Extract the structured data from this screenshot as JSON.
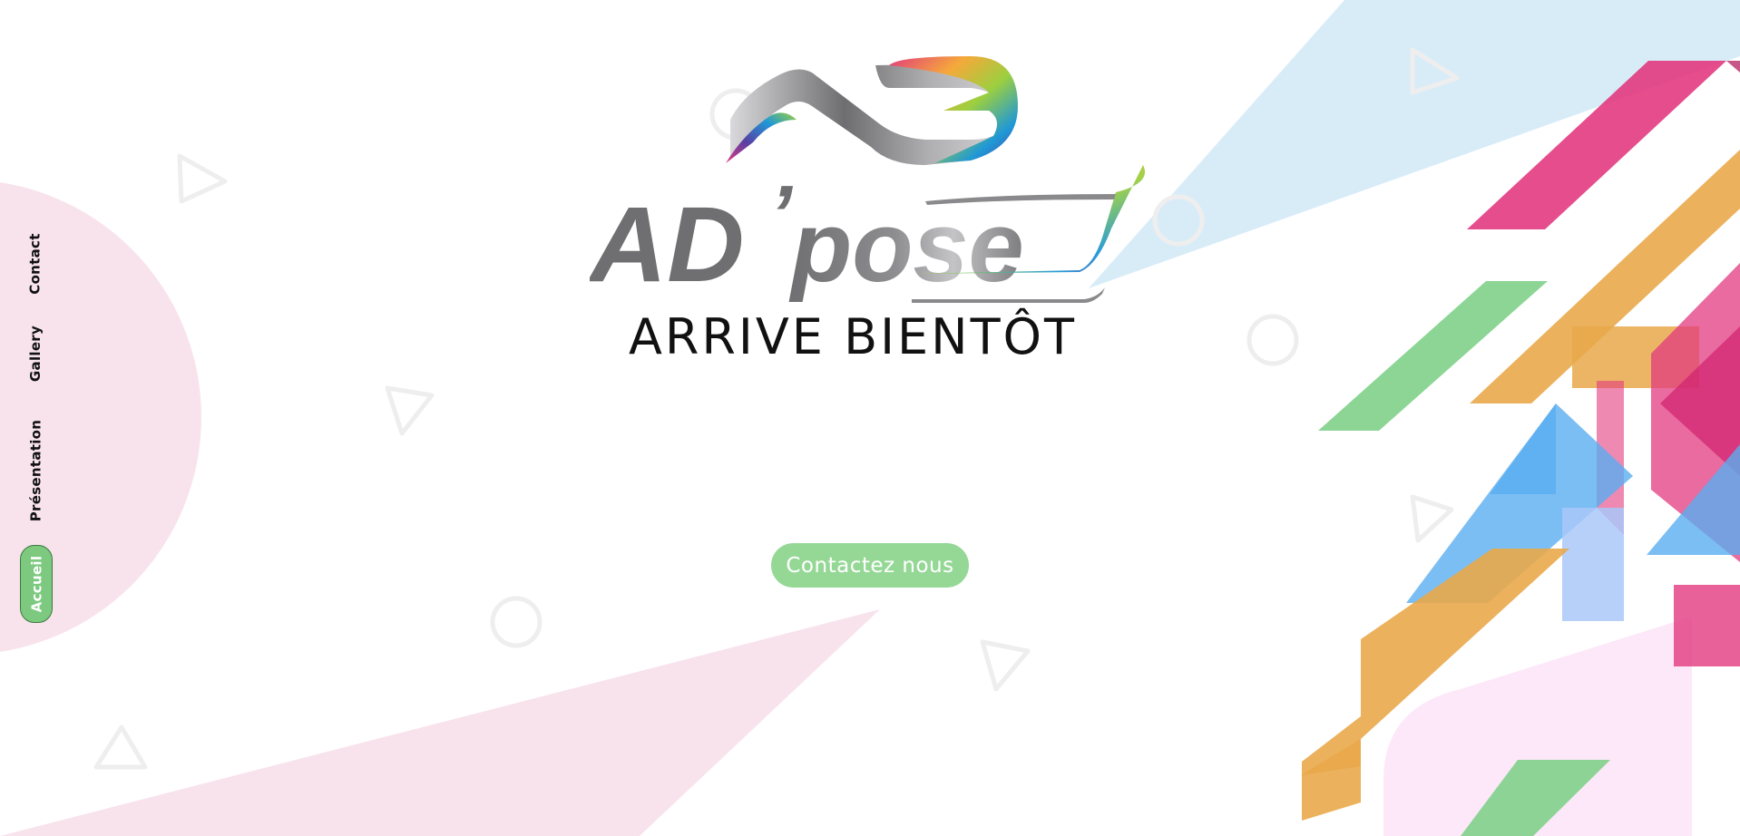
{
  "nav": {
    "items": [
      {
        "label": "Contact",
        "active": false
      },
      {
        "label": "Gallery",
        "active": false
      },
      {
        "label": "Présentation",
        "active": false
      },
      {
        "label": "Accueil",
        "active": true
      }
    ]
  },
  "logo": {
    "text_main": "AD",
    "text_apostrophe": "’",
    "text_pose": "pose"
  },
  "hero": {
    "headline": "ARRIVE BIENTÔT",
    "cta_label": "Contactez nous"
  },
  "colors": {
    "accent_green": "#95d896",
    "nav_active_green": "#7cc97f",
    "pink": "#e23a7f",
    "orange": "#e9a84a",
    "blue": "#5aaef0",
    "light_blue": "#d8ecf8",
    "light_pink": "#f8e3ec"
  }
}
